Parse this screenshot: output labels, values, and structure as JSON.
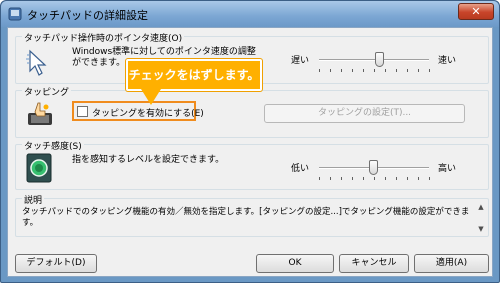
{
  "window": {
    "title": "タッチパッドの詳細設定",
    "close_label": "✕"
  },
  "pointer_speed": {
    "group_label": "タッチパッド操作時のポインタ速度(O)",
    "description_line1": "Windows標準に対してのポインタ速度の調整",
    "description_line2": "ができます。",
    "slow_label": "遅い",
    "fast_label": "速い",
    "slider_value_fraction": 0.55
  },
  "tapping": {
    "group_label": "タッピング",
    "checkbox_label": "タッピングを有効にする(E)",
    "checkbox_checked": false,
    "settings_button": "タッピングの設定(T)..."
  },
  "callout": {
    "text": "チェックをはずします。"
  },
  "touch_sensitivity": {
    "group_label": "タッチ感度(S)",
    "description": "指を感知するレベルを設定できます。",
    "low_label": "低い",
    "high_label": "高い",
    "slider_value_fraction": 0.5
  },
  "explanation": {
    "group_label": "説明",
    "line1": "タッチパッドでのタッピング機能の有効／無効を指定します。[タッピングの設定...]でタッピング機能の設定ができま",
    "line2": "す。"
  },
  "buttons": {
    "default": "デフォルト(D)",
    "ok": "OK",
    "cancel": "キャンセル",
    "apply": "適用(A)"
  },
  "colors": {
    "accent": "#ffb000",
    "highlight_border": "#f08c1e"
  }
}
